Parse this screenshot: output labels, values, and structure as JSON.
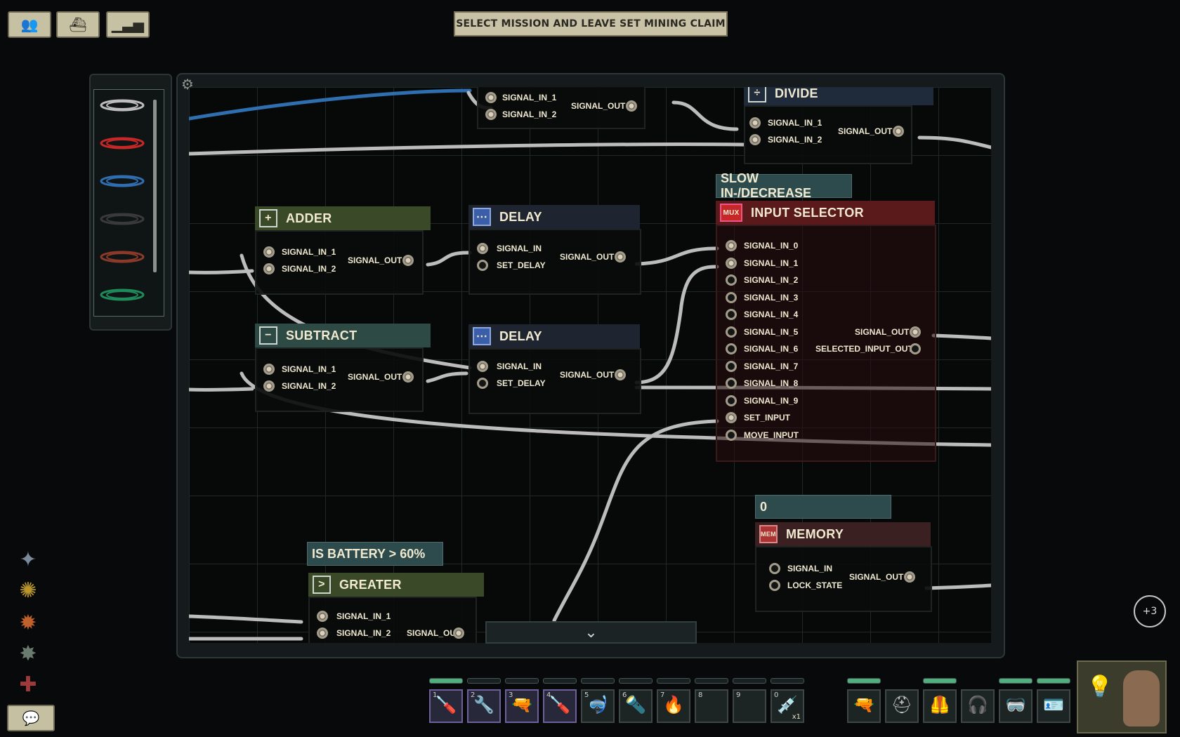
{
  "top_buttons": [
    {
      "icon": "crew-icon"
    },
    {
      "icon": "submarine-icon"
    },
    {
      "icon": "reputation-chart-icon"
    }
  ],
  "objective": "SELECT MISSION AND LEAVE SET MINING CLAIM",
  "wire_colors": [
    "#bdbdbd",
    "#c62828",
    "#2f6fb0",
    "#3a3a3a",
    "#8b3a2a",
    "#1f8a5a"
  ],
  "nodes": {
    "signal_top": {
      "pins": {
        "in1": "SIGNAL_IN_1",
        "in2": "SIGNAL_IN_2",
        "out": "SIGNAL_OUT"
      }
    },
    "divide": {
      "title": "DIVIDE",
      "pins": {
        "in1": "SIGNAL_IN_1",
        "in2": "SIGNAL_IN_2",
        "out": "SIGNAL_OUT"
      }
    },
    "adder": {
      "title": "ADDER",
      "icon": "+",
      "pins": {
        "in1": "SIGNAL_IN_1",
        "in2": "SIGNAL_IN_2",
        "out": "SIGNAL_OUT"
      }
    },
    "subtract": {
      "title": "SUBTRACT",
      "icon": "−",
      "pins": {
        "in1": "SIGNAL_IN_1",
        "in2": "SIGNAL_IN_2",
        "out": "SIGNAL_OUT"
      }
    },
    "delay1": {
      "title": "DELAY",
      "pins": {
        "in": "SIGNAL_IN",
        "set": "SET_DELAY",
        "out": "SIGNAL_OUT"
      }
    },
    "delay2": {
      "title": "DELAY",
      "pins": {
        "in": "SIGNAL_IN",
        "set": "SET_DELAY",
        "out": "SIGNAL_OUT"
      }
    },
    "input_selector": {
      "label": "SLOW IN-/DECREASE",
      "title": "INPUT SELECTOR",
      "icon": "MUX",
      "inputs": [
        "SIGNAL_IN_0",
        "SIGNAL_IN_1",
        "SIGNAL_IN_2",
        "SIGNAL_IN_3",
        "SIGNAL_IN_4",
        "SIGNAL_IN_5",
        "SIGNAL_IN_6",
        "SIGNAL_IN_7",
        "SIGNAL_IN_8",
        "SIGNAL_IN_9",
        "SET_INPUT",
        "MOVE_INPUT"
      ],
      "outputs": [
        "SIGNAL_OUT",
        "SELECTED_INPUT_OUT"
      ]
    },
    "memory": {
      "label": "0",
      "title": "MEMORY",
      "icon": "MEM",
      "pins": {
        "in": "SIGNAL_IN",
        "lock": "LOCK_STATE",
        "out": "SIGNAL_OUT"
      }
    },
    "greater": {
      "label": "IS BATTERY > 60%",
      "title": "GREATER",
      "icon": ">",
      "pins": {
        "in1": "SIGNAL_IN_1",
        "in2": "SIGNAL_IN_2",
        "out": "SIGNAL_OUT"
      }
    }
  },
  "hotbar": [
    {
      "num": "1",
      "icon": "screwdriver-icon",
      "selected": true
    },
    {
      "num": "2",
      "icon": "wrench-icon",
      "selected": true
    },
    {
      "num": "3",
      "icon": "gun-icon",
      "selected": true
    },
    {
      "num": "4",
      "icon": "screwdriver-icon",
      "selected": true
    },
    {
      "num": "5",
      "icon": "diving-mask-icon",
      "selected": false
    },
    {
      "num": "6",
      "icon": "flashlight-icon",
      "selected": false
    },
    {
      "num": "7",
      "icon": "welder-icon",
      "selected": false
    },
    {
      "num": "8",
      "icon": "",
      "selected": false
    },
    {
      "num": "9",
      "icon": "",
      "selected": false
    },
    {
      "num": "0",
      "icon": "syringe-icon",
      "selected": false,
      "count": "x1"
    }
  ],
  "equipment": [
    {
      "icon": "gun-icon"
    },
    {
      "icon": "helmet-icon"
    },
    {
      "icon": "vest-icon"
    },
    {
      "icon": "headset-icon"
    },
    {
      "icon": "goggles-icon"
    },
    {
      "icon": "id-card-icon"
    }
  ],
  "notification_count": "+3",
  "colors": {
    "accent": "#c9c2a6",
    "adder": "#3a4a28",
    "delay": "#1e2530",
    "selector": "#5a1a1c",
    "memory": "#3a2020",
    "tag": "#2d4a4d"
  }
}
